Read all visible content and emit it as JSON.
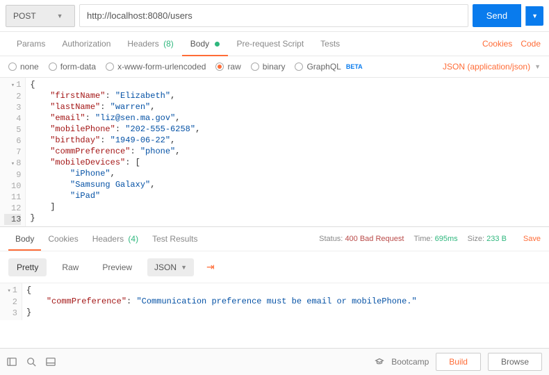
{
  "request": {
    "method": "POST",
    "url": "http://localhost:8080/users",
    "send_label": "Send"
  },
  "request_tabs": {
    "params": "Params",
    "authorization": "Authorization",
    "headers": "Headers",
    "headers_count": "(8)",
    "body": "Body",
    "prerequest": "Pre-request Script",
    "tests": "Tests",
    "cookies": "Cookies",
    "code": "Code"
  },
  "body_types": {
    "none": "none",
    "form_data": "form-data",
    "urlencoded": "x-www-form-urlencoded",
    "raw": "raw",
    "binary": "binary",
    "graphql": "GraphQL",
    "beta": "BETA",
    "content_type": "JSON (application/json)"
  },
  "request_body_lines": [
    "{",
    "    \"firstName\": \"Elizabeth\",",
    "    \"lastName\": \"warren\",",
    "    \"email\": \"liz@sen.ma.gov\",",
    "    \"mobilePhone\": \"202-555-6258\",",
    "    \"birthday\": \"1949-06-22\",",
    "    \"commPreference\": \"phone\",",
    "    \"mobileDevices\": [",
    "        \"iPhone\",",
    "        \"Samsung Galaxy\",",
    "        \"iPad\"",
    "    ]",
    "}"
  ],
  "response_tabs": {
    "body": "Body",
    "cookies": "Cookies",
    "headers": "Headers",
    "headers_count": "(4)",
    "test_results": "Test Results"
  },
  "response_meta": {
    "status_label": "Status:",
    "status_value": "400 Bad Request",
    "time_label": "Time:",
    "time_value": "695ms",
    "size_label": "Size:",
    "size_value": "233 B",
    "save": "Save"
  },
  "view": {
    "pretty": "Pretty",
    "raw": "Raw",
    "preview": "Preview",
    "format": "JSON"
  },
  "response_body_lines": [
    "{",
    "    \"commPreference\": \"Communication preference must be email or mobilePhone.\"",
    "}"
  ],
  "footer": {
    "bootcamp": "Bootcamp",
    "build": "Build",
    "browse": "Browse"
  }
}
